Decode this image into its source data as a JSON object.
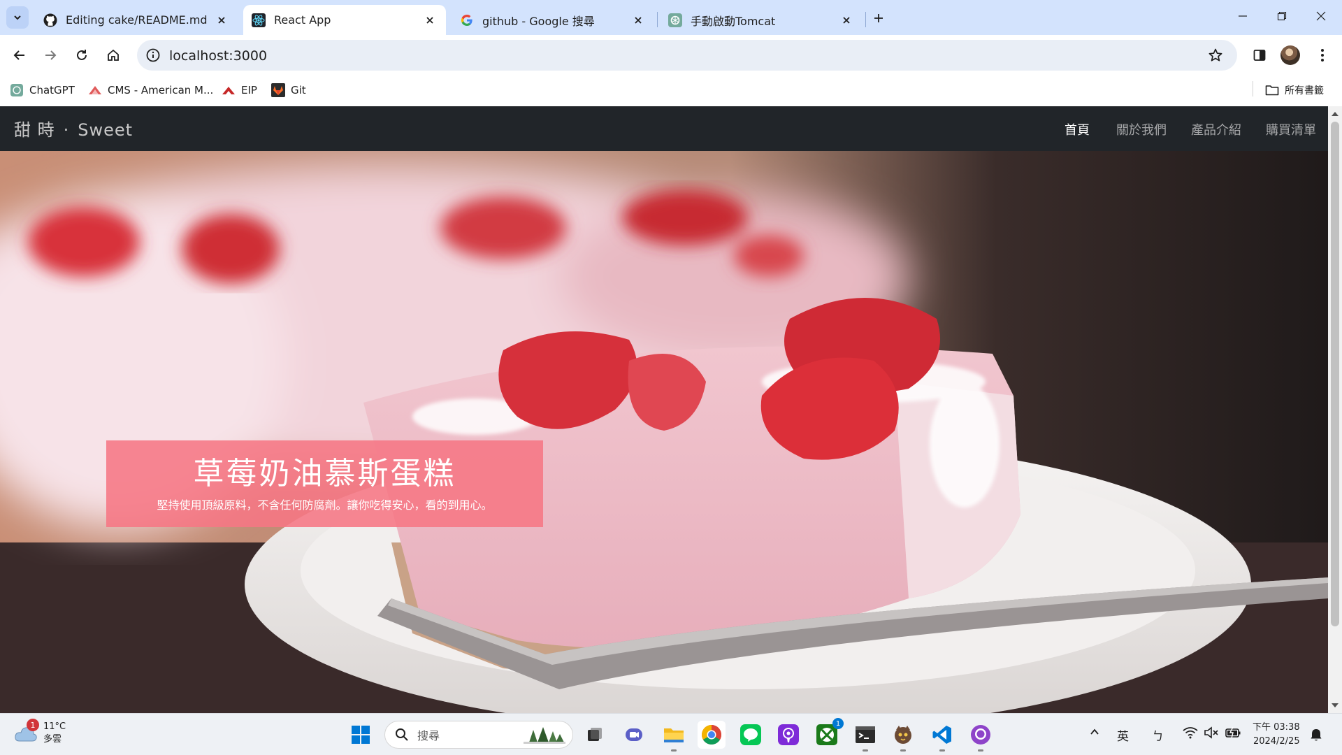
{
  "browser": {
    "tabs": [
      {
        "title": "Editing cake/README.md at m",
        "icon": "github-icon"
      },
      {
        "title": "React App",
        "icon": "react-icon",
        "active": true
      },
      {
        "title": "github - Google 搜尋",
        "icon": "google-icon"
      },
      {
        "title": "手動啟動Tomcat",
        "icon": "chatgpt-icon"
      }
    ],
    "url": "localhost:3000",
    "bookmarks": [
      {
        "label": "ChatGPT",
        "icon": "chatgpt-icon"
      },
      {
        "label": "CMS - American M...",
        "icon": "cms-icon"
      },
      {
        "label": "EIP",
        "icon": "eip-icon"
      },
      {
        "label": "Git",
        "icon": "gitlab-icon"
      }
    ],
    "all_bookmarks_label": "所有書籤"
  },
  "site": {
    "brand_primary": "甜 時",
    "brand_separator": "·",
    "brand_secondary": "Sweet",
    "nav": [
      {
        "label": "首頁",
        "active": true
      },
      {
        "label": "關於我們"
      },
      {
        "label": "產品介紹"
      },
      {
        "label": "購買清單"
      }
    ],
    "hero": {
      "heading": "草莓奶油慕斯蛋糕",
      "subheading": "堅持使用頂級原料，不含任何防腐劑。讓你吃得安心，看的到用心。",
      "caption_color": "#f67684"
    }
  },
  "taskbar": {
    "weather_temp": "11°C",
    "weather_desc": "多雲",
    "weather_badge": "1",
    "search_placeholder": "搜尋",
    "xbox_badge": "1",
    "ime_lang": "英",
    "ime_mode": "ㄅ",
    "time": "下午 03:38",
    "date": "2024/2/25"
  }
}
